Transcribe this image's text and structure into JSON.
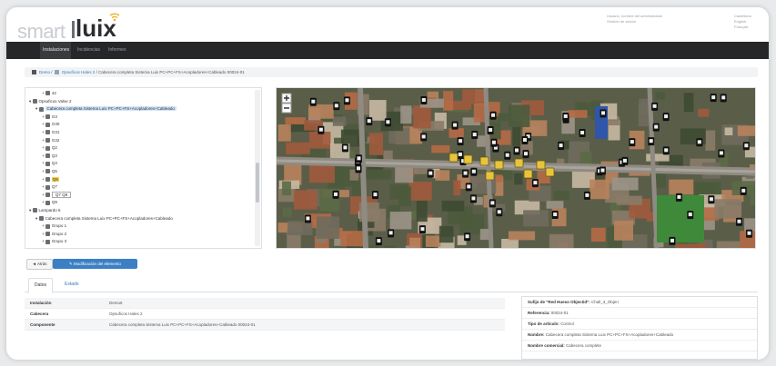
{
  "header": {
    "logo_smart": "smart",
    "logo_luix": "luix",
    "user_info": [
      "Usuario, nombre del administrador",
      "Gestión de sesión"
    ],
    "languages": [
      "Castellano",
      "English",
      "Français"
    ]
  },
  "nav": {
    "items": [
      "Instalaciones",
      "Incidencias",
      "Informes"
    ]
  },
  "breadcrumb": {
    "root": "Demo",
    "level2": "Opsuficos Hales 2",
    "current": "Cabecera completa Sistema Luix PC+PC+FS+Acopladores+Cableado 00024-01"
  },
  "tree": {
    "rows": [
      {
        "label": "42",
        "indent": 2,
        "kind": "plain"
      },
      {
        "label": "Opsuficos Valse 2",
        "indent": 0,
        "kind": "plain"
      },
      {
        "label": "Cabecera completa Sistema Luix PC+PC+FS+Acopladores+Cableado",
        "indent": 1,
        "kind": "selected"
      },
      {
        "label": "G3",
        "indent": 2,
        "kind": "plain"
      },
      {
        "label": "G30",
        "indent": 2,
        "kind": "plain"
      },
      {
        "label": "G31",
        "indent": 2,
        "kind": "plain"
      },
      {
        "label": "G32",
        "indent": 2,
        "kind": "plain"
      },
      {
        "label": "Q2",
        "indent": 2,
        "kind": "plain"
      },
      {
        "label": "Q3",
        "indent": 2,
        "kind": "plain"
      },
      {
        "label": "Q4",
        "indent": 2,
        "kind": "plain"
      },
      {
        "label": "Q5",
        "indent": 2,
        "kind": "plain"
      },
      {
        "label": "Q6",
        "indent": 2,
        "kind": "highlight"
      },
      {
        "label": "Q7",
        "indent": 2,
        "kind": "plain"
      },
      {
        "label": "Q7 Q8",
        "indent": 2,
        "kind": "boxed"
      },
      {
        "label": "Q9",
        "indent": 2,
        "kind": "plain"
      },
      {
        "label": "Lampardo 6",
        "indent": 0,
        "kind": "plain"
      },
      {
        "label": "Cabecera completa Sistema Luix PC+PC+FS+Acopladores+Cableado",
        "indent": 1,
        "kind": "plain"
      },
      {
        "label": "Grupo 1",
        "indent": 2,
        "kind": "plain"
      },
      {
        "label": "Grupo 2",
        "indent": 2,
        "kind": "plain"
      },
      {
        "label": "Grupo 3",
        "indent": 2,
        "kind": "plain"
      }
    ]
  },
  "buttons": {
    "back": "◄ Atrás",
    "modify": "✎ Modificación del elemento"
  },
  "tabs": [
    "Datos",
    "Estado"
  ],
  "details": [
    {
      "label": "Instalación",
      "value": "Demo6"
    },
    {
      "label": "Cabecera",
      "value": "Opsuficos Hales 2"
    },
    {
      "label": "Componente",
      "value": "Cabecera completa Sistema Luix PC+PC+FS+Acopladores+Cableado 00024-01"
    }
  ],
  "props": [
    {
      "label": "Sufijo de \"Red Hueso Objectid\":",
      "value": "Chall_3_Objeri"
    },
    {
      "label": "Referencia:",
      "value": "00024-01"
    },
    {
      "label": "Tipo de artículo:",
      "value": "Control"
    },
    {
      "label": "Nombre:",
      "value": "Cabecera completa Sistema Luix PC+PC+FS+Acopladores+Cableado"
    },
    {
      "label": "Nombre comercial:",
      "value": "Cabecera complete"
    }
  ],
  "colors": {
    "nav_bg": "#262729",
    "primary_button": "#3b7fc4",
    "link": "#337ab7",
    "marker_highlight": "#f5d14a",
    "selection": "#cfe4f7"
  },
  "icons": {
    "wifi": "wifi-icon",
    "home": "home-icon",
    "folder": "folder-icon",
    "map_marker": "marker-icon",
    "zoom_in": "zoom-in-icon",
    "zoom_out": "zoom-out-icon"
  }
}
